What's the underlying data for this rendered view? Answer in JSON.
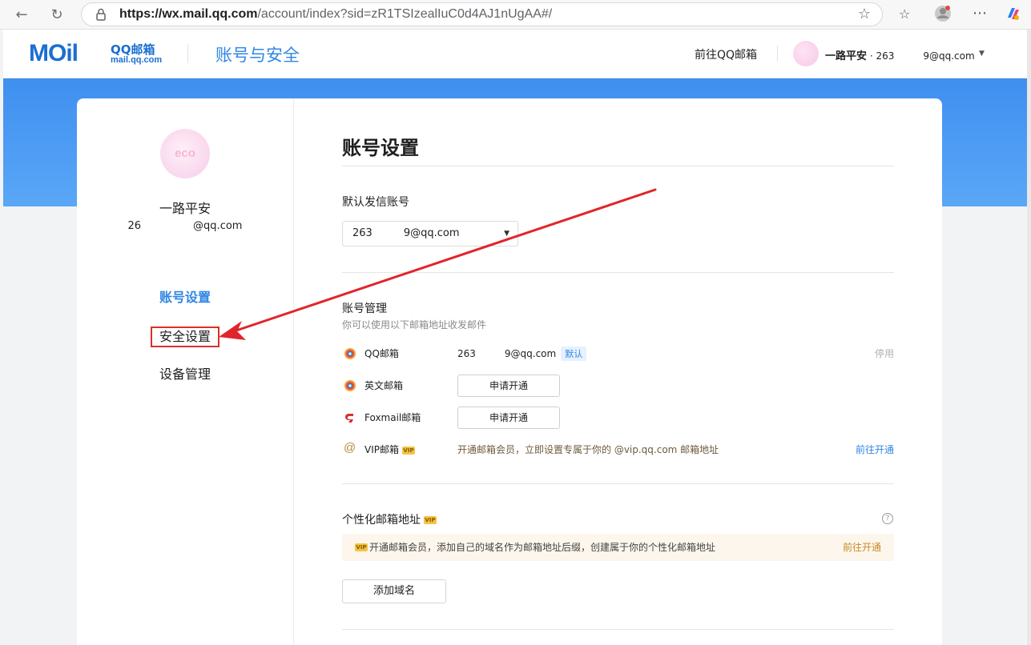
{
  "browser": {
    "url_host": "https://wx.mail.qq.com",
    "url_path": "/account/index?sid=zR1TSIzealIuC0d4AJ1nUgAA#/"
  },
  "header": {
    "logo_mail": "MOil",
    "logo_qq": "QQ邮箱",
    "logo_domain": "mail.qq.com",
    "title": "账号与安全",
    "goto_mail": "前往QQ邮箱",
    "user_nick": "一路平安",
    "user_email": " · 263   9@qq.com"
  },
  "profile": {
    "avatar_tag": "eco",
    "name": "一路平安",
    "email": "26     @qq.com"
  },
  "sidebar": {
    "items": [
      {
        "label": "账号设置"
      },
      {
        "label": "安全设置"
      },
      {
        "label": "设备管理"
      }
    ]
  },
  "main": {
    "title": "账号设置",
    "default_sender": {
      "label": "默认发信账号",
      "value": "263   9@qq.com"
    },
    "account_mgmt": {
      "label": "账号管理",
      "sub": "你可以使用以下邮箱地址收发邮件",
      "rows": [
        {
          "name": "QQ邮箱",
          "value": "263   9@qq.com",
          "badge": "默认",
          "action": "停用"
        },
        {
          "name": "英文邮箱",
          "button": "申请开通"
        },
        {
          "name": "Foxmail邮箱",
          "button": "申请开通"
        },
        {
          "name": "VIP邮箱",
          "value": "开通邮箱会员，立即设置专属于你的 @vip.qq.com 邮箱地址",
          "action": "前往开通"
        }
      ]
    },
    "personal": {
      "label": "个性化邮箱地址",
      "banner_text": "开通邮箱会员，添加自己的域名作为邮箱地址后缀，创建属于你的个性化邮箱地址",
      "banner_link": "前往开通",
      "add_domain": "添加域名"
    },
    "vip_badge": "VIP"
  },
  "colors": {
    "accent": "#2f86e3",
    "band": "#4a9af3",
    "annotation": "#e0252b"
  }
}
